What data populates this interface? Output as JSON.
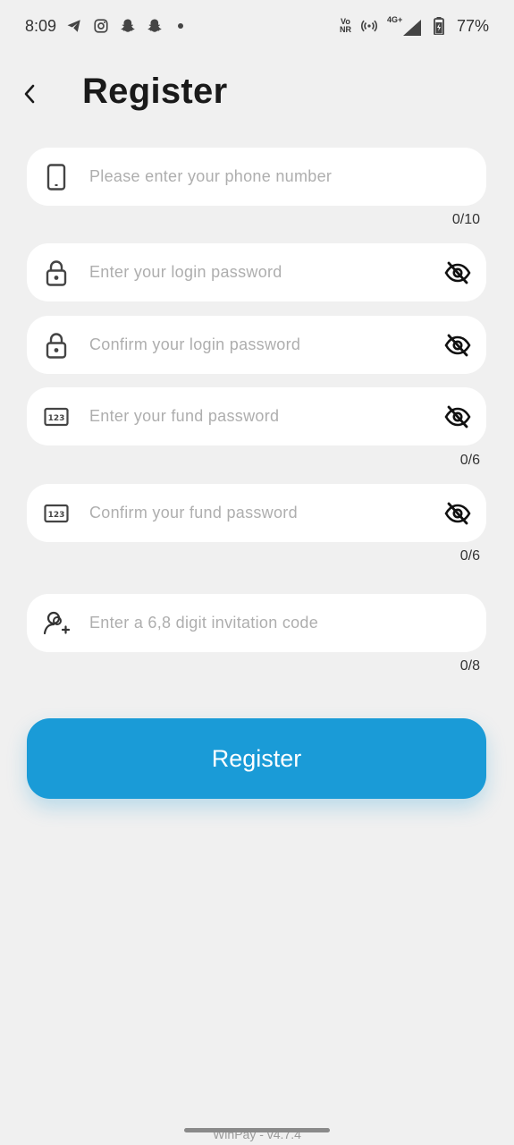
{
  "status_bar": {
    "time": "8:09",
    "network_top": "Vo",
    "network_bottom": "NR",
    "signal_label": "4G+",
    "battery": "77%",
    "icons": [
      "telegram-icon",
      "instagram-icon",
      "snapchat-icon",
      "snapchat-icon",
      "dot-icon",
      "volte-icon",
      "hotspot-icon",
      "signal-icon",
      "battery-icon"
    ]
  },
  "header": {
    "title": "Register",
    "back_icon": "chevron-left-icon"
  },
  "form": {
    "phone": {
      "placeholder": "Please enter your phone number",
      "counter": "0/10",
      "icon": "phone-icon"
    },
    "login_password": {
      "placeholder": "Enter your login password",
      "icon": "lock-icon",
      "toggle_icon": "eye-off-icon"
    },
    "confirm_login_password": {
      "placeholder": "Confirm your login password",
      "icon": "lock-icon",
      "toggle_icon": "eye-off-icon"
    },
    "fund_password": {
      "placeholder": "Enter your fund password",
      "counter": "0/6",
      "icon": "numeric-keypad-icon",
      "toggle_icon": "eye-off-icon"
    },
    "confirm_fund_password": {
      "placeholder": "Confirm your fund password",
      "counter": "0/6",
      "icon": "numeric-keypad-icon",
      "toggle_icon": "eye-off-icon"
    },
    "invitation_code": {
      "placeholder": "Enter a 6,8 digit invitation code",
      "counter": "0/8",
      "icon": "invite-user-icon"
    }
  },
  "register_button": {
    "label": "Register"
  },
  "footer": {
    "version": "WinPay - v4.7.4"
  },
  "colors": {
    "background": "#f0f0f0",
    "field_bg": "#ffffff",
    "accent": "#1a9bd7",
    "placeholder": "#aeaeae",
    "text": "#1a1a1a"
  }
}
